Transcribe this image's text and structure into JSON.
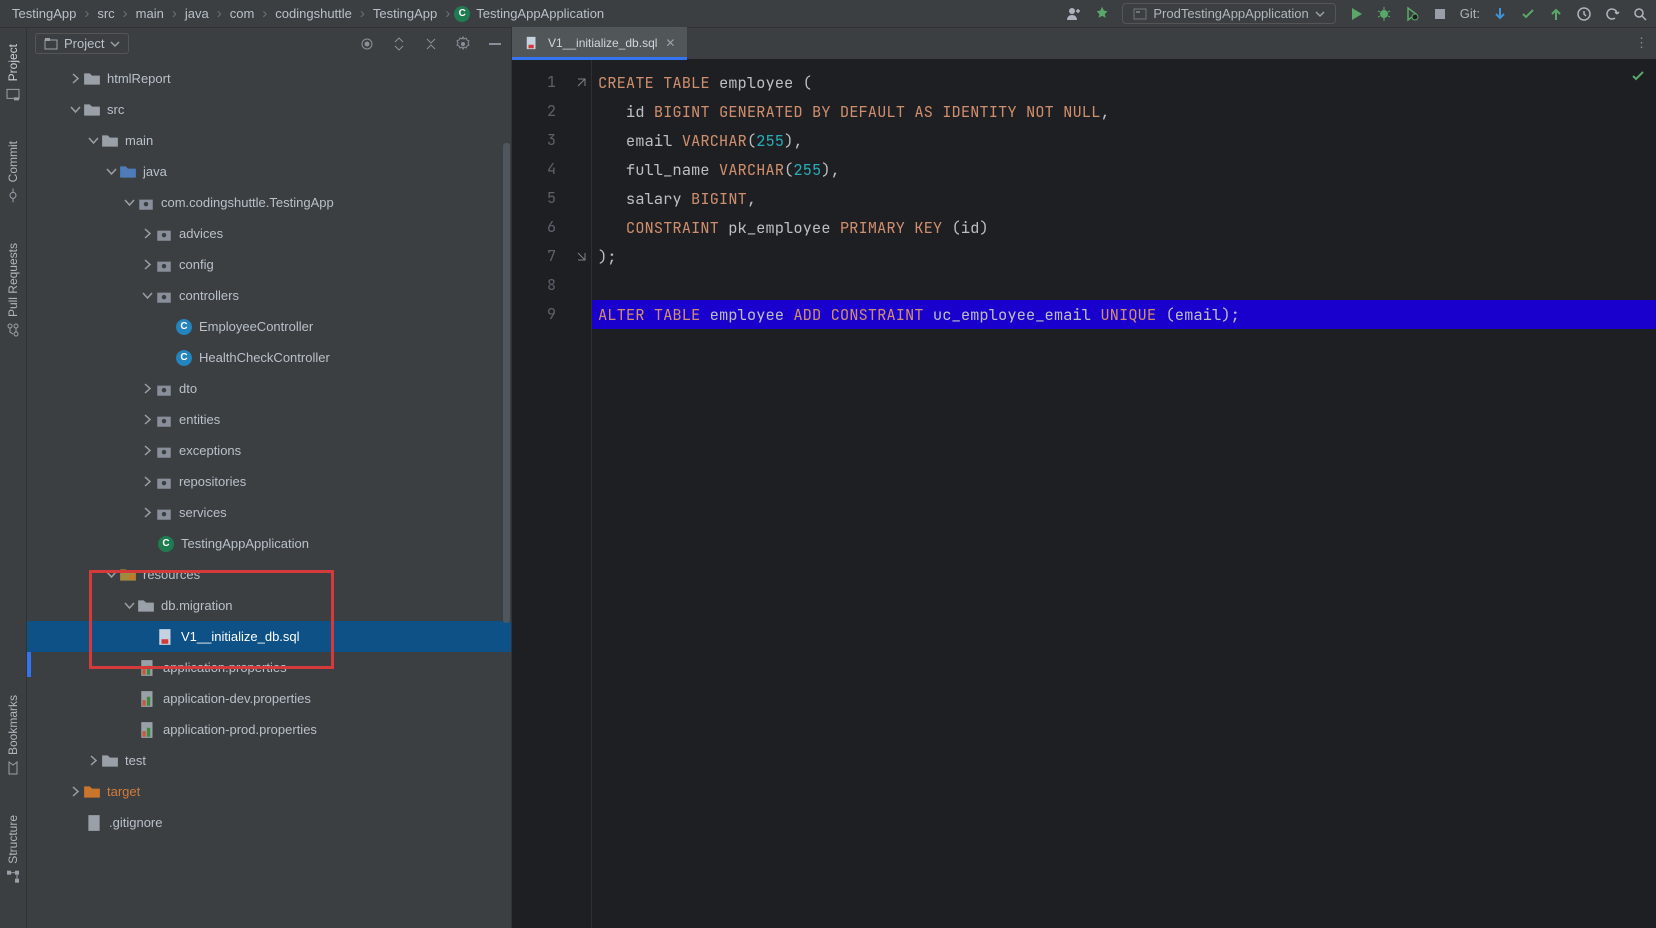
{
  "breadcrumbs": [
    "TestingApp",
    "src",
    "main",
    "java",
    "com",
    "codingshuttle",
    "TestingApp",
    "TestingAppApplication"
  ],
  "run_config": "ProdTestingAppApplication",
  "git_label": "Git:",
  "left_tabs": [
    "Project",
    "Commit",
    "Pull Requests",
    "Bookmarks",
    "Structure"
  ],
  "project_panel": {
    "title": "Project"
  },
  "tree": {
    "htmlReport": "htmlReport",
    "src": "src",
    "main": "main",
    "java": "java",
    "pkg": "com.codingshuttle.TestingApp",
    "advices": "advices",
    "config": "config",
    "controllers": "controllers",
    "EmployeeController": "EmployeeController",
    "HealthCheckController": "HealthCheckController",
    "dto": "dto",
    "entities": "entities",
    "exceptions": "exceptions",
    "repositories": "repositories",
    "services": "services",
    "TestingAppApplication": "TestingAppApplication",
    "resources": "resources",
    "dbmigration": "db.migration",
    "V1": "V1__initialize_db.sql",
    "appprops": "application.properties",
    "appdev": "application-dev.properties",
    "appprod": "application-prod.properties",
    "test": "test",
    "target": "target",
    "gitignore": ".gitignore"
  },
  "tab": {
    "label": "V1__initialize_db.sql"
  },
  "code_lines": {
    "n1": "1",
    "n2": "2",
    "n3": "3",
    "n4": "4",
    "n5": "5",
    "n6": "6",
    "n7": "7",
    "n8": "8",
    "n9": "9"
  }
}
